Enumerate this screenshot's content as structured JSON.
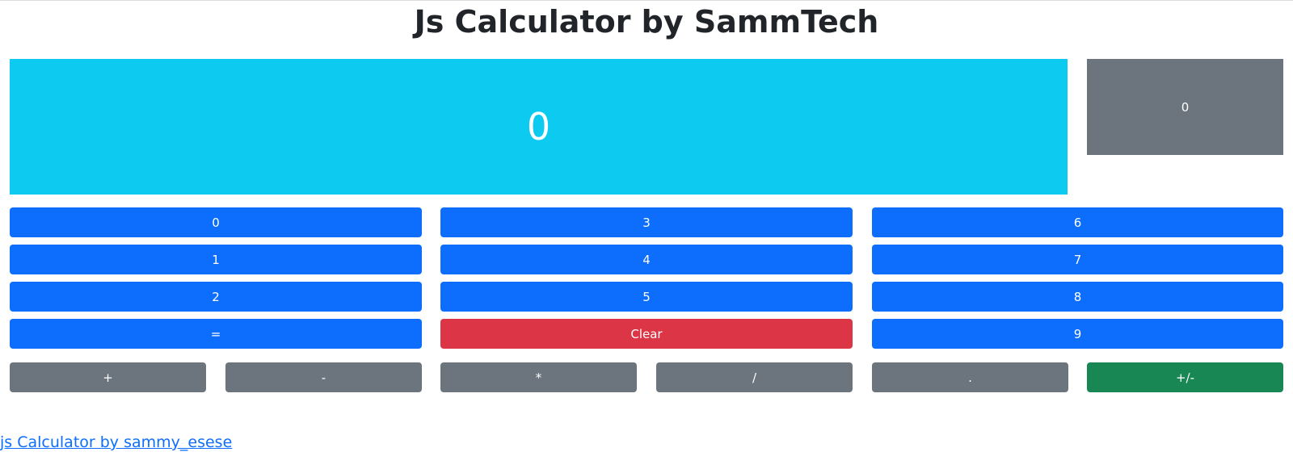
{
  "page": {
    "title": "Js Calculator by SammTech"
  },
  "display": {
    "value": "0",
    "memory_value": "0"
  },
  "buttons": {
    "digit_0": "0",
    "digit_1": "1",
    "digit_2": "2",
    "digit_3": "3",
    "digit_4": "4",
    "digit_5": "5",
    "digit_6": "6",
    "digit_7": "7",
    "digit_8": "8",
    "digit_9": "9",
    "equals": "=",
    "clear": "Clear",
    "plus": "+",
    "minus": "-",
    "multiply": "*",
    "divide": "/",
    "decimal": ".",
    "negate": "+/-"
  },
  "footer": {
    "link_text": "js Calculator by sammy_esese"
  },
  "colors": {
    "display_bg": "#0dcaf0",
    "memory_bg": "#6c757d",
    "primary": "#0d6efd",
    "danger": "#dc3545",
    "secondary": "#6c757d",
    "success": "#198754"
  }
}
